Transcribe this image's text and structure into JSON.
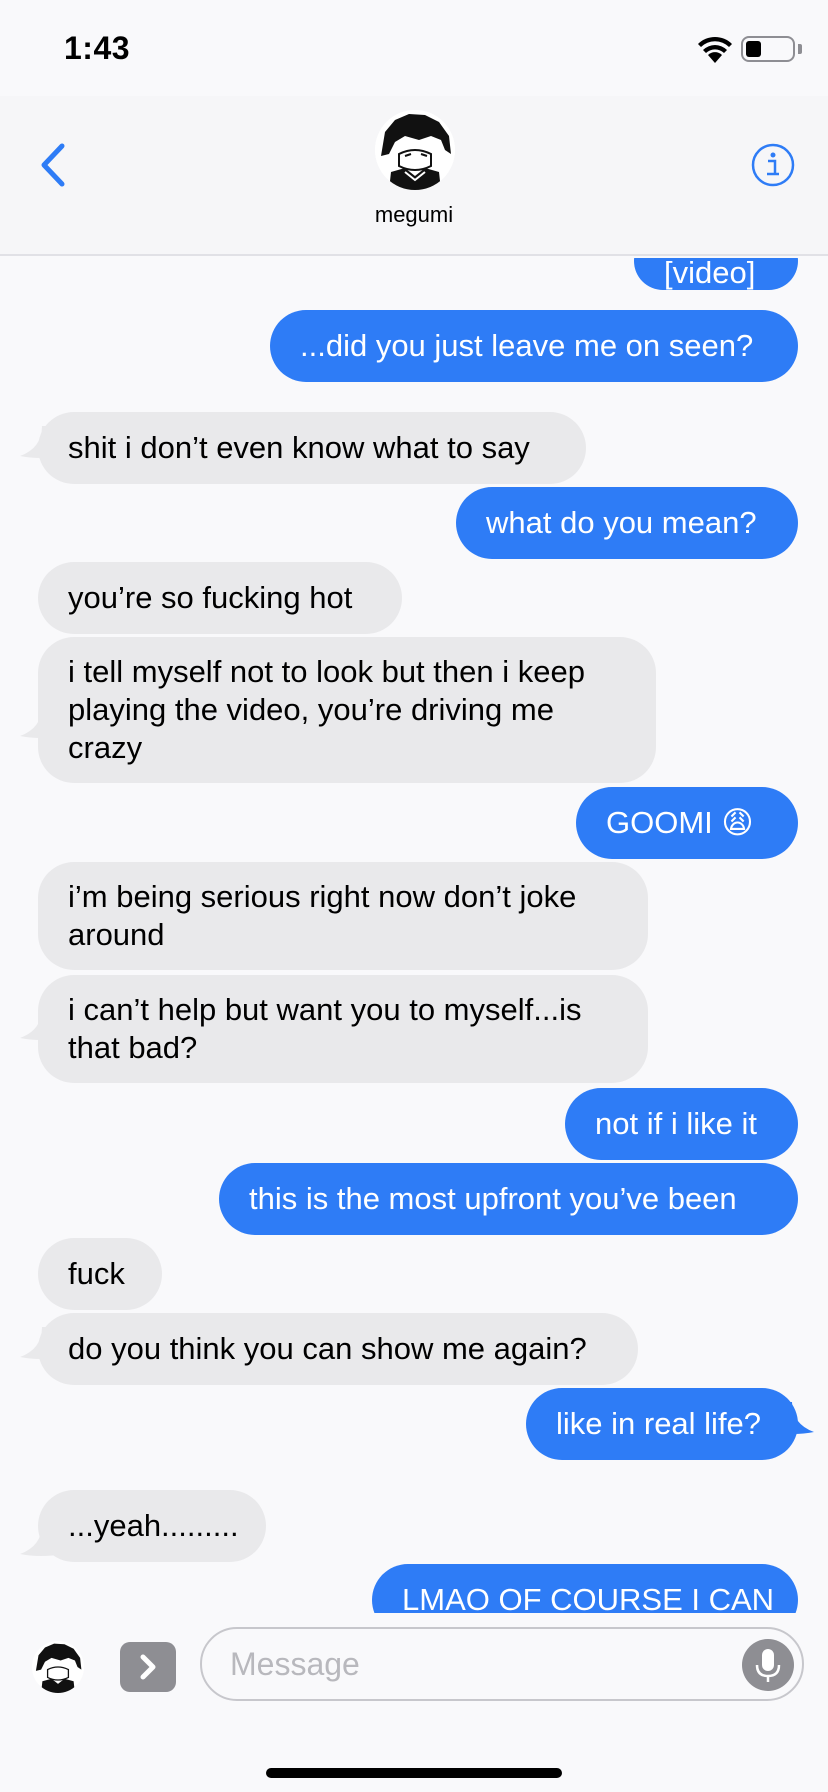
{
  "status_bar": {
    "time": "1:43",
    "wifi_icon": "wifi-icon",
    "battery_icon": "battery-icon",
    "battery_level": 0.35
  },
  "header": {
    "back_icon": "chevron-left-icon",
    "contact_name": "megumi",
    "avatar_icon": "contact-avatar",
    "info_icon": "info-icon"
  },
  "messages": [
    {
      "sender": "me",
      "text": "[video]"
    },
    {
      "sender": "me",
      "text": "...did you just leave me on seen?"
    },
    {
      "sender": "them",
      "text": "shit i don’t even know what to say"
    },
    {
      "sender": "me",
      "text": "what do you mean?"
    },
    {
      "sender": "them",
      "text": "you’re so fucking hot"
    },
    {
      "sender": "them",
      "text": "i tell myself not to look but then i keep playing the video, you’re driving me crazy"
    },
    {
      "sender": "me",
      "text": "GOOMI 😩"
    },
    {
      "sender": "them",
      "text": "i’m being serious right now don’t joke around"
    },
    {
      "sender": "them",
      "text": "i can’t help but want you to myself...is that bad?"
    },
    {
      "sender": "me",
      "text": "not if i like it"
    },
    {
      "sender": "me",
      "text": "this is the most upfront you’ve been"
    },
    {
      "sender": "them",
      "text": "fuck"
    },
    {
      "sender": "them",
      "text": "do you think you can show me again?"
    },
    {
      "sender": "me",
      "text": "like in real life?"
    },
    {
      "sender": "them",
      "text": "...yeah........."
    },
    {
      "sender": "me",
      "text": "LMAO OF COURSE I CAN"
    }
  ],
  "input_bar": {
    "placeholder": "Message",
    "apps_icon": "chevron-right-icon",
    "mic_icon": "microphone-icon"
  },
  "colors": {
    "sent_bubble": "#2e7cf6",
    "received_bubble": "#e9e9eb",
    "accent": "#2e7cf6"
  }
}
